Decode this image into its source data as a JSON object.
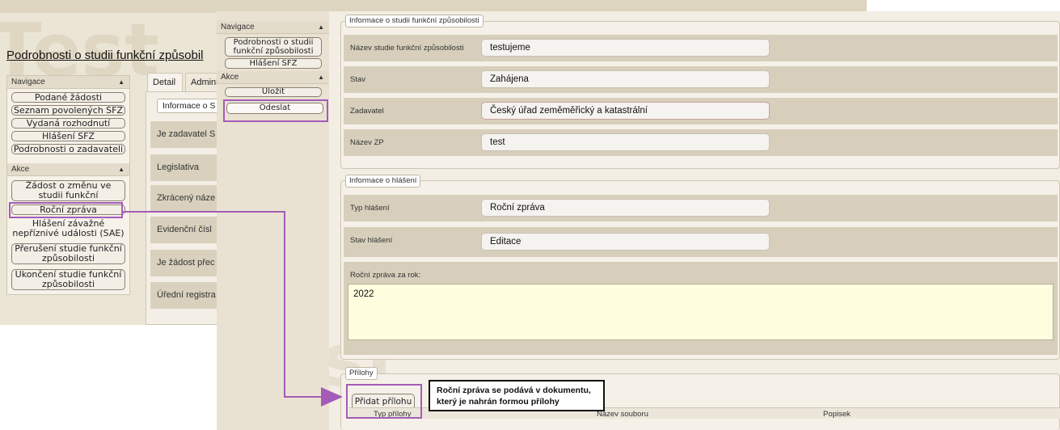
{
  "back": {
    "watermark": "Test",
    "title": "Podrobnosti o studii funkční způsobil",
    "nav": {
      "header": "Navigace",
      "items": [
        "Podané žádosti",
        "Seznam povolených SFZ",
        "Vydaná rozhodnutí",
        "Hlášení SFZ",
        "Podrobnosti o zadavateli"
      ]
    },
    "actions": {
      "header": "Akce",
      "items": [
        "Žádost o změnu ve studii funkční způsobilosti",
        "Roční zpráva",
        "Hlášení závažné nepříznivé události (SAE)",
        "Přerušení studie funkční způsobilosti",
        "Ukončení studie funkční způsobilosti"
      ]
    },
    "tabs": [
      "Detail",
      "Admini"
    ],
    "section_legend": "Informace o S",
    "rows": [
      "Je zadavatel S",
      "Legislativa",
      "Zkrácený náze",
      "Evidenční čísl",
      "Je žádost přec",
      "Úřední registra"
    ]
  },
  "front": {
    "nav": {
      "header": "Navigace",
      "items": [
        "Podrobnosti o studii funkční způsobilosti",
        "Hlášení SFZ"
      ]
    },
    "actions": {
      "header": "Akce",
      "items": [
        "Uložit",
        "Odeslat"
      ]
    },
    "study_info": {
      "legend": "Informace o studii funkční způsobilosti",
      "fields": [
        {
          "label": "Název studie funkční způsobilosti",
          "value": "testujeme"
        },
        {
          "label": "Stav",
          "value": "Zahájena"
        },
        {
          "label": "Zadavatel",
          "value": "Český úřad zeměměřický a katastrální"
        },
        {
          "label": "Název ZP",
          "value": "test"
        }
      ]
    },
    "report_info": {
      "legend": "Informace o hlášení",
      "fields": [
        {
          "label": "Typ hlášení",
          "value": "Roční zpráva"
        },
        {
          "label": "Stav hlášení",
          "value": "Editace"
        }
      ],
      "year_label": "Roční zpráva za rok:",
      "year_value": "2022"
    },
    "attachments": {
      "legend": "Přílohy",
      "add_button": "Přidat přílohu",
      "columns": [
        "Typ přílohy",
        "Název souboru",
        "Popisek"
      ]
    }
  },
  "annotation": {
    "callout": "Roční zpráva se podává v dokumentu, který je nahrán formou přílohy",
    "color": "#a45cb8"
  }
}
